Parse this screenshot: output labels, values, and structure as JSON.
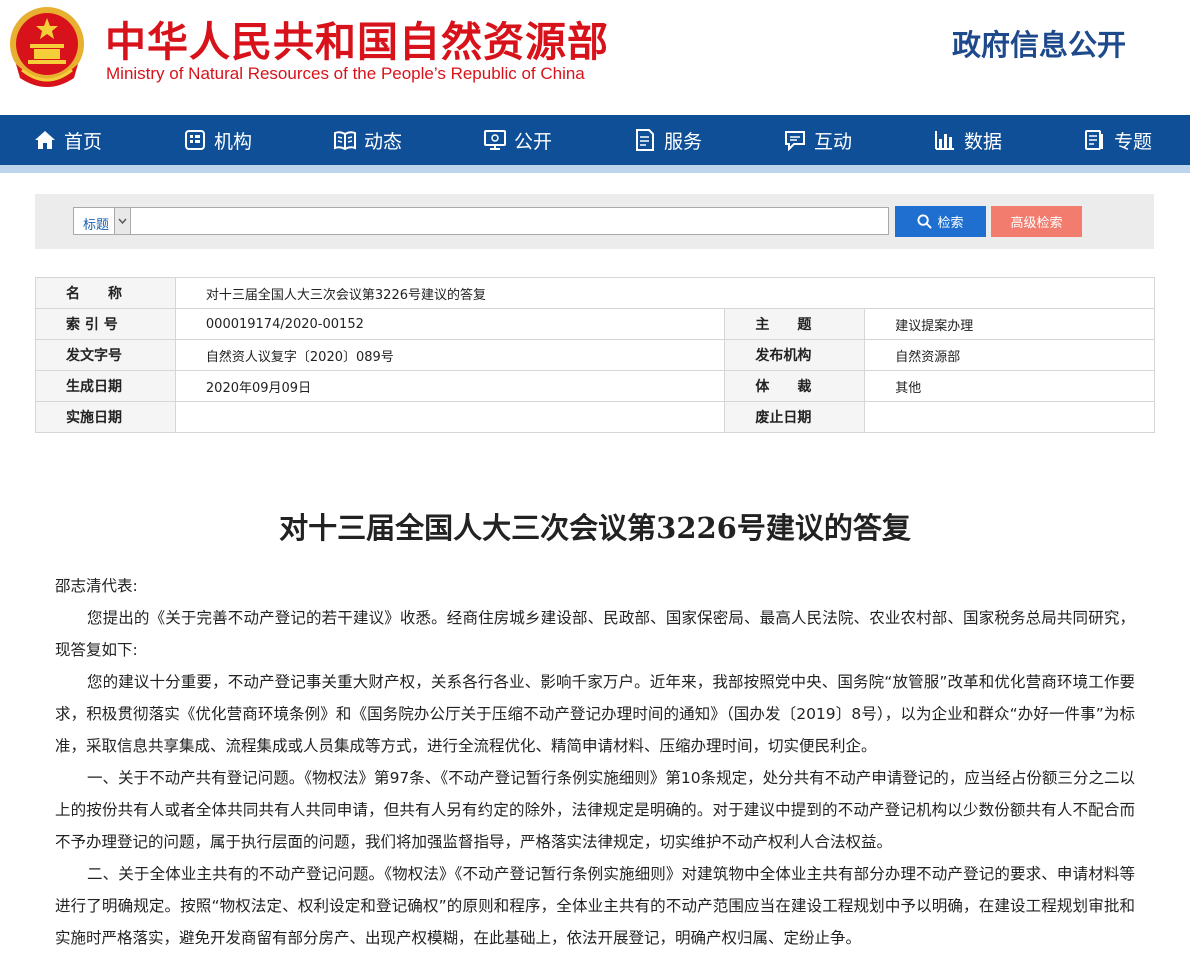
{
  "header": {
    "site_name_cn": "中华人民共和国自然资源部",
    "site_name_en": "Ministry of Natural Resources of the People’s Republic of China",
    "section_title": "政府信息公开"
  },
  "nav": [
    {
      "label": "首页",
      "icon": "home-icon"
    },
    {
      "label": "机构",
      "icon": "organization-icon"
    },
    {
      "label": "动态",
      "icon": "book-icon"
    },
    {
      "label": "公开",
      "icon": "monitor-icon"
    },
    {
      "label": "服务",
      "icon": "service-doc-icon"
    },
    {
      "label": "互动",
      "icon": "chat-icon"
    },
    {
      "label": "数据",
      "icon": "bar-chart-icon"
    },
    {
      "label": "专题",
      "icon": "topic-icon"
    }
  ],
  "search": {
    "field_selected": "标题",
    "input_value": "",
    "search_label": "检索",
    "advanced_label": "高级检索"
  },
  "meta": {
    "name_label": "名　　称",
    "name_value": "对十三届全国人大三次会议第3226号建议的答复",
    "index_label": "索 引 号",
    "index_value": "000019174/2020-00152",
    "topic_label": "主　　题",
    "topic_value": "建议提案办理",
    "doc_no_label": "发文字号",
    "doc_no_value": "自然资人议复字〔2020〕089号",
    "issuer_label": "发布机构",
    "issuer_value": "自然资源部",
    "date_label": "生成日期",
    "date_value": "2020年09月09日",
    "genre_label": "体　　裁",
    "genre_value": "其他",
    "impl_label": "实施日期",
    "impl_value": "",
    "abolish_label": "废止日期",
    "abolish_value": ""
  },
  "article": {
    "title": "对十三届全国人大三次会议第3226号建议的答复",
    "salutation": "邵志清代表:",
    "paragraphs": [
      "您提出的《关于完善不动产登记的若干建议》收悉。经商住房城乡建设部、民政部、国家保密局、最高人民法院、农业农村部、国家税务总局共同研究，现答复如下:",
      "您的建议十分重要，不动产登记事关重大财产权，关系各行各业、影响千家万户。近年来，我部按照党中央、国务院“放管服”改革和优化营商环境工作要求，积极贯彻落实《优化营商环境条例》和《国务院办公厅关于压缩不动产登记办理时间的通知》（国办发〔2019〕8号），以为企业和群众“办好一件事”为标准，采取信息共享集成、流程集成或人员集成等方式，进行全流程优化、精简申请材料、压缩办理时间，切实便民利企。",
      "一、关于不动产共有登记问题。《物权法》第97条、《不动产登记暂行条例实施细则》第10条规定，处分共有不动产申请登记的，应当经占份额三分之二以上的按份共有人或者全体共同共有人共同申请，但共有人另有约定的除外，法律规定是明确的。对于建议中提到的不动产登记机构以少数份额共有人不配合而不予办理登记的问题，属于执行层面的问题，我们将加强监督指导，严格落实法律规定，切实维护不动产权利人合法权益。",
      "二、关于全体业主共有的不动产登记问题。《物权法》《不动产登记暂行条例实施细则》对建筑物中全体业主共有部分办理不动产登记的要求、申请材料等进行了明确规定。按照“物权法定、权利设定和登记确权”的原则和程序，全体业主共有的不动产范围应当在建设工程规划中予以明确，在建设工程规划审批和实施时严格落实，避免开发商留有部分房产、出现产权模糊，在此基础上，依法开展登记，明确产权归属、定纷止争。"
    ]
  },
  "colors": {
    "brand_red": "#d8121a",
    "nav_blue": "#0f4f98",
    "search_blue": "#1e6fd0",
    "advanced_salmon": "#f27c6e"
  }
}
